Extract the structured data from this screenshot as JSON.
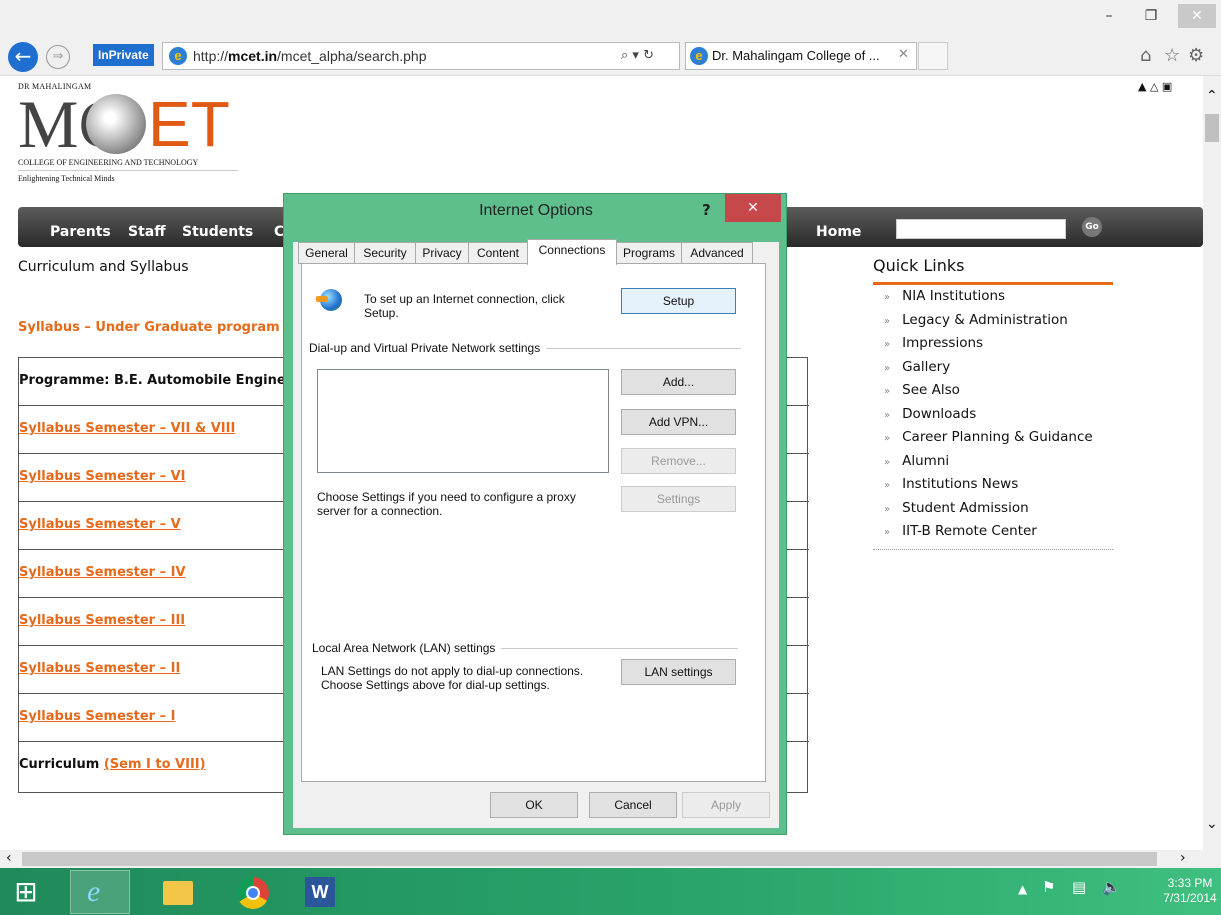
{
  "browser": {
    "inprivate": "InPrivate",
    "url_prefix": "http://",
    "url_domain": "mcet.in",
    "url_path": "/mcet_alpha/search.php",
    "tab_title": "Dr. Mahalingam College of ...",
    "search_ctl": "⌕ ▾ ↻"
  },
  "logo": {
    "top": "DR MAHALINGAM",
    "mc": "MC",
    "et": "ET",
    "bottom": "COLLEGE OF ENGINEERING AND TECHNOLOGY",
    "tagline": "Enlightening Technical Minds"
  },
  "nav": {
    "items": [
      "Parents",
      "Staff",
      "Students",
      "C",
      "Home"
    ],
    "go": "Go"
  },
  "content": {
    "breadcrumb": "Curriculum and Syllabus",
    "ug_heading": "Syllabus – Under Graduate program",
    "programme": "Programme: B.E. Automobile Engine",
    "rows": [
      "Syllabus Semester – VII & VIII",
      "Syllabus Semester – VI",
      "Syllabus Semester – V",
      "Syllabus Semester – IV",
      "Syllabus Semester – III",
      "Syllabus Semester – II",
      "Syllabus Semester – I"
    ],
    "curriculum_label": "Curriculum",
    "curriculum_link": "(Sem I to VIII)"
  },
  "quick_links": {
    "title": "Quick Links",
    "items": [
      "NIA Institutions",
      "Legacy & Administration",
      "Impressions",
      "Gallery",
      "See Also",
      "Downloads",
      "Career Planning & Guidance",
      "Alumni",
      "Institutions News",
      "Student Admission",
      "IIT-B Remote Center"
    ]
  },
  "dialog": {
    "title": "Internet Options",
    "help": "?",
    "close": "✕",
    "tabs": [
      "General",
      "Security",
      "Privacy",
      "Content",
      "Connections",
      "Programs",
      "Advanced"
    ],
    "active_tab": "Connections",
    "setup_text_1": "To set up an Internet connection, click",
    "setup_text_2": "Setup.",
    "setup_button": "Setup",
    "dialup_group": "Dial-up and Virtual Private Network settings",
    "add_button": "Add...",
    "add_vpn_button": "Add VPN...",
    "remove_button": "Remove...",
    "proxy_text_1": "Choose Settings if you need to configure a proxy",
    "proxy_text_2": "server for a connection.",
    "settings_button": "Settings",
    "lan_group": "Local Area Network (LAN) settings",
    "lan_text_1": "LAN Settings do not apply to dial-up connections.",
    "lan_text_2": "Choose Settings above for dial-up settings.",
    "lan_button": "LAN settings",
    "ok": "OK",
    "cancel": "Cancel",
    "apply": "Apply"
  },
  "taskbar": {
    "time": "3:33 PM",
    "date": "7/31/2014",
    "colors": {
      "taskbar": "#2aa56b",
      "dialog_frame": "#5fbf8c",
      "accent": "#e66a1a",
      "ie_blue": "#1f6fd0"
    }
  }
}
